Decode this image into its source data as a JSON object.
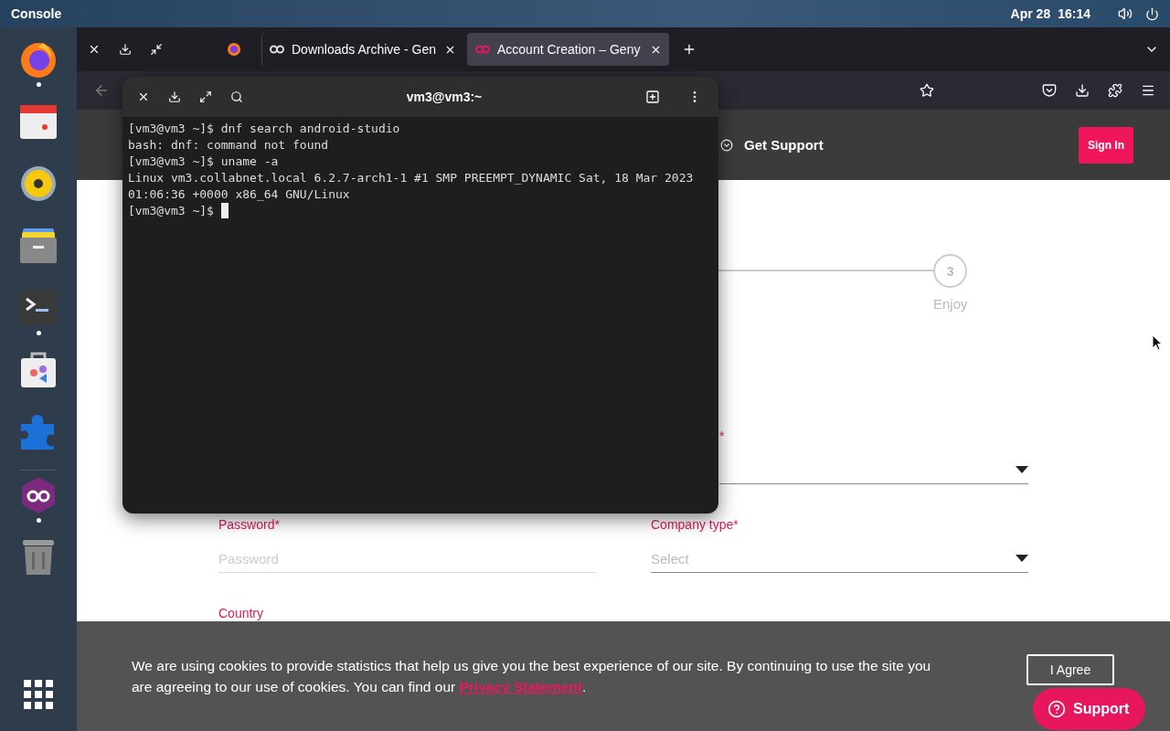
{
  "top_bar": {
    "activities": "Console",
    "date": "Apr 28",
    "time": "16:14"
  },
  "dock": {
    "items": [
      {
        "kind": "browser",
        "running": true
      },
      {
        "kind": "calendar",
        "running": false
      },
      {
        "kind": "speaker",
        "running": false
      },
      {
        "kind": "files",
        "running": false
      },
      {
        "kind": "terminal",
        "running": true
      },
      {
        "kind": "software",
        "running": false
      },
      {
        "kind": "extensions",
        "running": false
      },
      {
        "kind": "genymotion",
        "running": true
      },
      {
        "kind": "trash",
        "running": false
      }
    ]
  },
  "browser": {
    "tabs": [
      {
        "kind": "pinned",
        "selected": false
      },
      {
        "kind": "normal",
        "title": "Downloads Archive - Gen",
        "selected": false
      },
      {
        "kind": "normal",
        "title": "Account Creation – Geny",
        "selected": true
      }
    ]
  },
  "page": {
    "header": {
      "support_link": "Get Support",
      "sign_in": "Sign In"
    },
    "stepper": {
      "number": "3",
      "label": "Enjoy"
    },
    "fields": [
      {
        "kind": "select",
        "required_mark": "*"
      },
      {
        "kind": "input",
        "label": "Password",
        "required_mark": "*",
        "placeholder": "Password"
      },
      {
        "kind": "select",
        "label": "Company type",
        "required_mark": "*",
        "value": "Select"
      },
      {
        "kind": "hidden",
        "label": "Country"
      }
    ],
    "cookie_banner": {
      "text": "We are using cookies to provide statistics that help us give you the best experience of our site. By continuing to use the site you are agreeing to our use of cookies. You can find our ",
      "link": "Privacy Statement",
      "after": ".",
      "button": "I Agree"
    },
    "support_button": "Support"
  },
  "terminal": {
    "title": "vm3@vm3:~",
    "lines": [
      "[vm3@vm3 ~]$ dnf search android-studio",
      "bash: dnf: command not found",
      "[vm3@vm3 ~]$ uname -a",
      "Linux vm3.collabnet.local 6.2.7-arch1-1 #1 SMP PREEMPT_DYNAMIC Sat, 18 Mar 2023",
      "01:06:36 +0000 x86_64 GNU/Linux",
      "[vm3@vm3 ~]$ "
    ],
    "cursor": true
  }
}
